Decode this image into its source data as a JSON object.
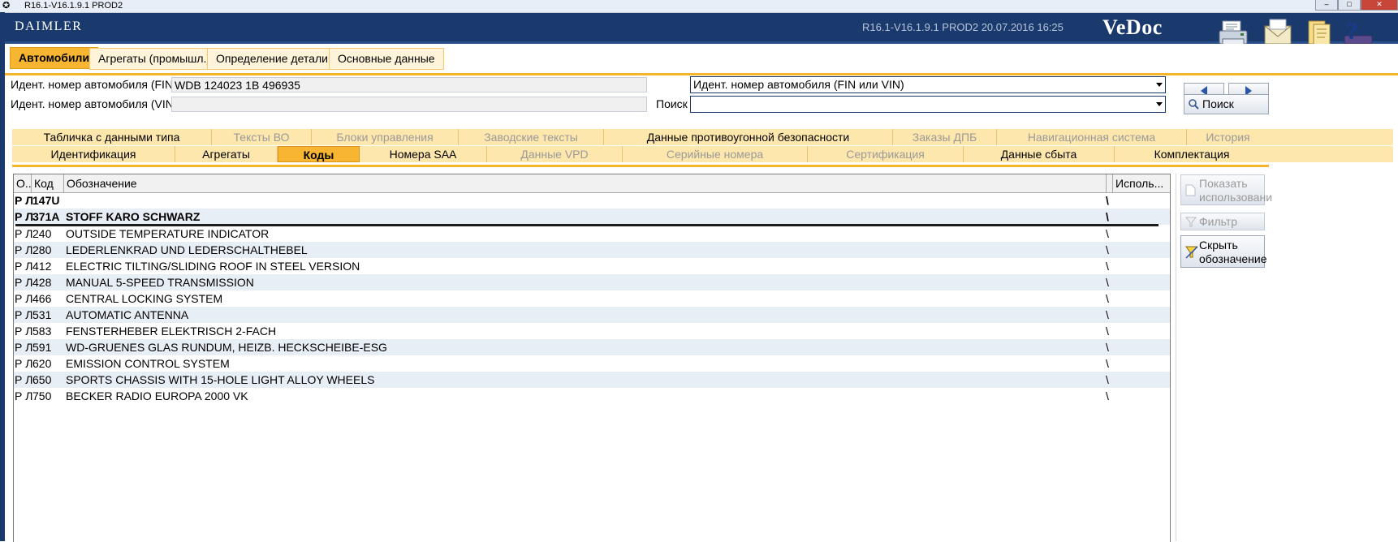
{
  "window": {
    "title": "R16.1-V16.1.9.1  PROD2",
    "controls": [
      "–",
      "□",
      "✕"
    ]
  },
  "header": {
    "brand": "DAIMLER",
    "version": "R16.1-V16.1.9.1  PROD2 20.07.2016 16:25",
    "product": "VeDoc",
    "icons": [
      "printer-icon",
      "mail-icon",
      "notes-icon",
      "help-icon"
    ]
  },
  "main_tabs": [
    {
      "label": "Автомобили",
      "active": true
    },
    {
      "label": "Агрегаты (промышл.)",
      "active": false
    },
    {
      "label": "Определение детали",
      "active": false
    },
    {
      "label": "Основные данные",
      "active": false
    }
  ],
  "form": {
    "fin_label": "Идент. номер автомобиля (FIN)",
    "fin_value": "WDB 124023 1B 496935",
    "vin_label": "Идент. номер автомобиля (VIN)",
    "vin_value": "",
    "type_select": "Идент. номер автомобиля (FIN или VIN)",
    "search_label": "Поиск",
    "search_value": "",
    "search_button": "Поиск"
  },
  "sub_tabs_row1": [
    {
      "label": "Табличка с данными типа",
      "enabled": true
    },
    {
      "label": "Тексты ВО",
      "enabled": false
    },
    {
      "label": "Блоки управления",
      "enabled": false
    },
    {
      "label": "Заводские тексты",
      "enabled": false
    },
    {
      "label": "Данные противоугонной безопасности",
      "enabled": true
    },
    {
      "label": "Заказы ДПБ",
      "enabled": false
    },
    {
      "label": "Навигационная система",
      "enabled": false
    },
    {
      "label": "История",
      "enabled": false
    }
  ],
  "sub_tabs_row2": [
    {
      "label": "Идентификация",
      "enabled": true,
      "active": false
    },
    {
      "label": "Агрегаты",
      "enabled": true,
      "active": false
    },
    {
      "label": "Коды",
      "enabled": true,
      "active": true
    },
    {
      "label": "Номера SAA",
      "enabled": true,
      "active": false
    },
    {
      "label": "Данные VPD",
      "enabled": false,
      "active": false
    },
    {
      "label": "Серийные номера",
      "enabled": false,
      "active": false
    },
    {
      "label": "Сертификация",
      "enabled": false,
      "active": false
    },
    {
      "label": "Данные сбыта",
      "enabled": true,
      "active": false
    },
    {
      "label": "Комплектация",
      "enabled": true,
      "active": false
    }
  ],
  "grid": {
    "columns": [
      "О...",
      "Код",
      "Обозначение",
      "Исполь..."
    ],
    "rows": [
      {
        "o": "Р Л",
        "code": "147U",
        "designation": "",
        "use": "\\",
        "bold": true
      },
      {
        "o": "Р Л",
        "code": "371A",
        "designation": "STOFF KARO SCHWARZ",
        "use": "\\",
        "bold": true
      },
      {
        "o": "Р Л",
        "code": "240",
        "designation": "OUTSIDE TEMPERATURE INDICATOR",
        "use": "\\",
        "bold": false
      },
      {
        "o": "Р Л",
        "code": "280",
        "designation": "LEDERLENKRAD UND LEDERSCHALTHEBEL",
        "use": "\\",
        "bold": false
      },
      {
        "o": "Р Л",
        "code": "412",
        "designation": "ELECTRIC TILTING/SLIDING ROOF IN STEEL VERSION",
        "use": "\\",
        "bold": false
      },
      {
        "o": "Р Л",
        "code": "428",
        "designation": "MANUAL 5-SPEED TRANSMISSION",
        "use": "\\",
        "bold": false
      },
      {
        "o": "Р Л",
        "code": "466",
        "designation": "CENTRAL LOCKING SYSTEM",
        "use": "\\",
        "bold": false
      },
      {
        "o": "Р Л",
        "code": "531",
        "designation": "AUTOMATIC ANTENNA",
        "use": "\\",
        "bold": false
      },
      {
        "o": "Р Л",
        "code": "583",
        "designation": "FENSTERHEBER ELEKTRISCH 2-FACH",
        "use": "\\",
        "bold": false
      },
      {
        "o": "Р Л",
        "code": "591",
        "designation": "WD-GRUENES GLAS RUNDUM, HEIZB. HECKSCHEIBE-ESG",
        "use": "\\",
        "bold": false
      },
      {
        "o": "Р Л",
        "code": "620",
        "designation": "EMISSION CONTROL SYSTEM",
        "use": "\\",
        "bold": false
      },
      {
        "o": "Р Л",
        "code": "650",
        "designation": "SPORTS CHASSIS WITH 15-HOLE LIGHT ALLOY WHEELS",
        "use": "\\",
        "bold": false
      },
      {
        "o": "Р Л",
        "code": "750",
        "designation": "BECKER RADIO EUROPA 2000 VK",
        "use": "\\",
        "bold": false
      }
    ]
  },
  "side_buttons": {
    "show_usage": "Показать использовани",
    "filter": "Фильтр",
    "hide_designation": "Скрыть обозначение"
  },
  "colors": {
    "header_bg": "#1a3a6e",
    "accent": "#f7b531",
    "tab_bg": "#fde7ad"
  }
}
